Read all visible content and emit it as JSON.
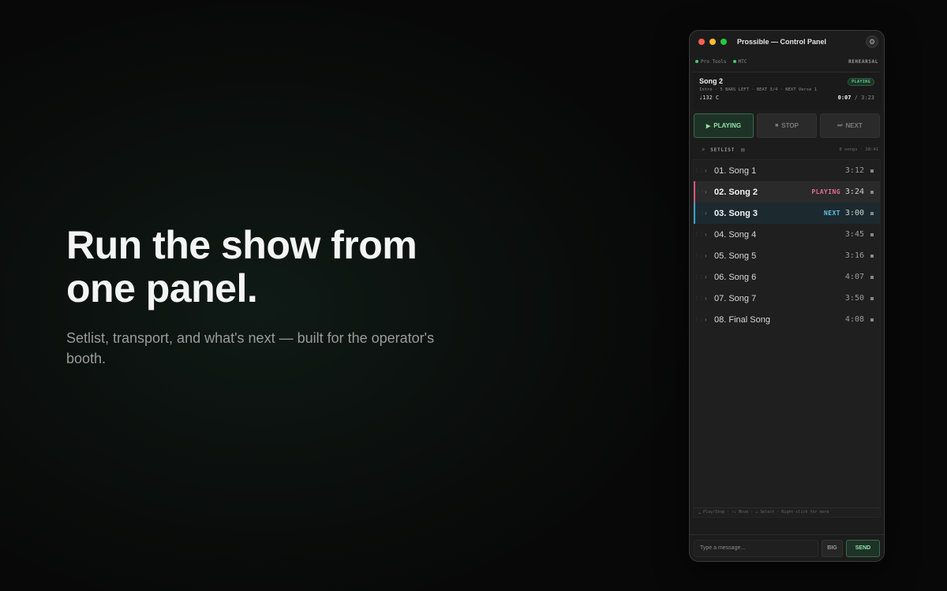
{
  "hero": {
    "headline": "Run the show from\none panel.",
    "subhead": "Setlist, transport, and what's next — built for the operator's booth."
  },
  "window": {
    "title": "Prossible — Control Panel",
    "settings_icon": "gear-icon",
    "status": {
      "sources": [
        {
          "label": "Pro Tools",
          "color": "#3ecf6e"
        },
        {
          "label": "MTC",
          "color": "#3ecf6e"
        }
      ],
      "mode": "REHEARSAL"
    },
    "now_playing": {
      "title": "Song 2",
      "badge": "PLAYING",
      "section": "Intro · 5 BARS LEFT · BEAT 3/4 · NEXT Verse 1",
      "tempo": "♩132",
      "key": "C",
      "elapsed": "0:07",
      "separator": "/",
      "total": "3:23"
    },
    "transport": {
      "play": {
        "glyph": "▶",
        "label": "PLAYING"
      },
      "stop": {
        "glyph": "■",
        "label": "STOP"
      },
      "next": {
        "glyph": "⏭",
        "label": "NEXT"
      }
    },
    "setlist": {
      "label": "SETLIST",
      "summary": "8 songs · 28:41",
      "songs": [
        {
          "name": "01. Song 1",
          "duration": "3:12",
          "flag": "",
          "state": ""
        },
        {
          "name": "02. Song 2",
          "duration": "3:24",
          "flag": "PLAYING",
          "state": "playing"
        },
        {
          "name": "03. Song 3",
          "duration": "3:00",
          "flag": "NEXT",
          "state": "next"
        },
        {
          "name": "04. Song 4",
          "duration": "3:45",
          "flag": "",
          "state": ""
        },
        {
          "name": "05. Song 5",
          "duration": "3:16",
          "flag": "",
          "state": ""
        },
        {
          "name": "06. Song 6",
          "duration": "4:07",
          "flag": "",
          "state": ""
        },
        {
          "name": "07. Song 7",
          "duration": "3:50",
          "flag": "",
          "state": ""
        },
        {
          "name": "08. Final Song",
          "duration": "4:08",
          "flag": "",
          "state": ""
        }
      ]
    },
    "hints": "␣ Play/Stop · ↑↓ Move · ↵ Select · Right-click for more",
    "composer": {
      "placeholder": "Type a message...",
      "big_label": "BIG",
      "send_label": "SEND"
    },
    "colors": {
      "playing": "#d6577c",
      "next": "#3aa3c7",
      "accent_green": "#8fe0a9"
    }
  }
}
